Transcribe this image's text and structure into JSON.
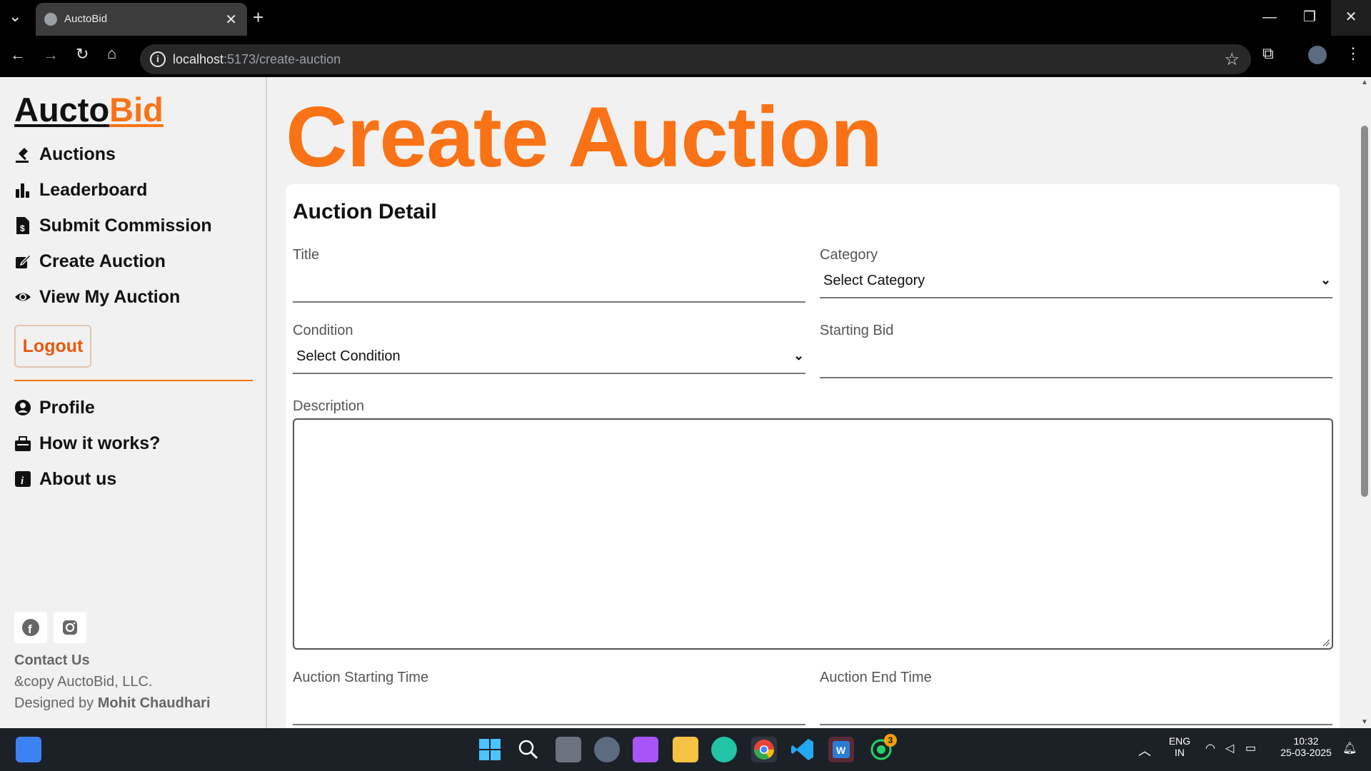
{
  "browser": {
    "tab_title": "AuctoBid",
    "url_host": "localhost",
    "url_path": ":5173/create-auction"
  },
  "sidebar": {
    "logo_part1": "Aucto",
    "logo_part2": "Bid",
    "items": [
      {
        "label": "Auctions",
        "icon": "gavel-icon"
      },
      {
        "label": "Leaderboard",
        "icon": "bar-chart-icon"
      },
      {
        "label": "Submit Commission",
        "icon": "receipt-dollar-icon"
      },
      {
        "label": "Create Auction",
        "icon": "edit-icon"
      },
      {
        "label": "View My Auction",
        "icon": "eye-icon"
      }
    ],
    "logout_label": "Logout",
    "items2": [
      {
        "label": "Profile",
        "icon": "user-circle-icon"
      },
      {
        "label": "How it works?",
        "icon": "toolbox-icon"
      },
      {
        "label": "About us",
        "icon": "info-icon"
      }
    ],
    "contact_label": "Contact Us",
    "copyright": "&copy AuctoBid, LLC.",
    "designed_by_prefix": "Designed by ",
    "designer": "Mohit Chaudhari"
  },
  "main": {
    "heading": "Create Auction",
    "card_title": "Auction Detail",
    "fields": {
      "title_label": "Title",
      "category_label": "Category",
      "category_value": "Select Category",
      "condition_label": "Condition",
      "condition_value": "Select Condition",
      "starting_bid_label": "Starting Bid",
      "description_label": "Description",
      "start_time_label": "Auction Starting Time",
      "end_time_label": "Auction End Time"
    }
  },
  "taskbar": {
    "lang_line1": "ENG",
    "lang_line2": "IN",
    "time": "10:32",
    "date": "25-03-2025",
    "whatsapp_badge": "3"
  },
  "colors": {
    "accent": "#f97316",
    "chrome_bg": "#000000",
    "page_bg": "#f1f1f1"
  }
}
